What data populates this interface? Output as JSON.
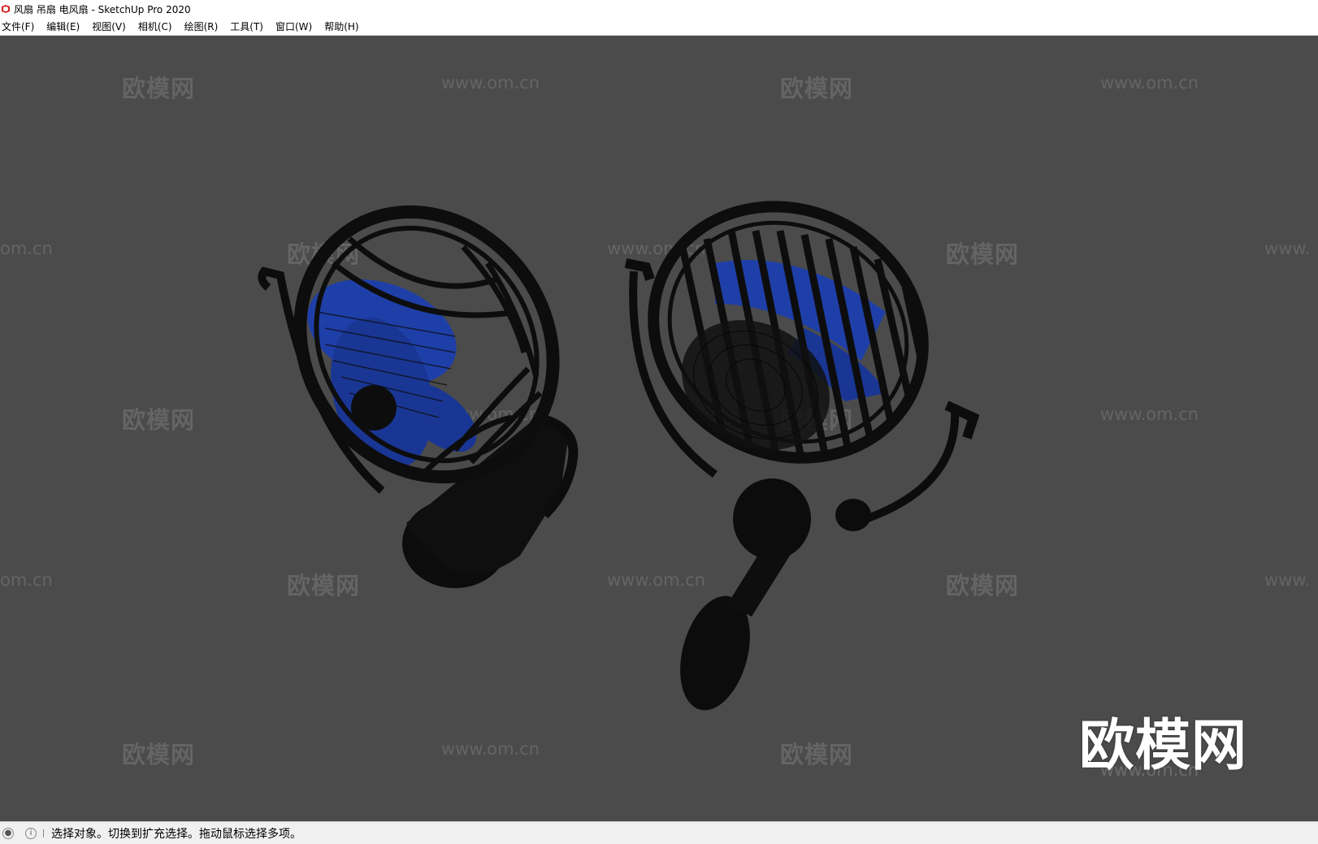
{
  "window": {
    "title": "风扇 吊扇 电风扇 - SketchUp Pro 2020",
    "app_icon": "sketchup-logo-icon"
  },
  "menu": {
    "items": [
      {
        "label": "文件(F)"
      },
      {
        "label": "编辑(E)"
      },
      {
        "label": "视图(V)"
      },
      {
        "label": "相机(C)"
      },
      {
        "label": "绘图(R)"
      },
      {
        "label": "工具(T)"
      },
      {
        "label": "窗口(W)"
      },
      {
        "label": "帮助(H)"
      }
    ]
  },
  "viewport": {
    "background": "#4b4b4b",
    "model_color": "#101010",
    "blade_color": "#1f3fa8",
    "watermark_cn": "欧模网",
    "watermark_url": "www.om.cn",
    "watermark_url_partial": "om.cn",
    "watermark_url_cut": "www.",
    "logo_text": "欧模网"
  },
  "status": {
    "geo_icon": "location-pin-icon",
    "info_icon": "info-icon",
    "message": "选择对象。切换到扩充选择。拖动鼠标选择多项。"
  }
}
